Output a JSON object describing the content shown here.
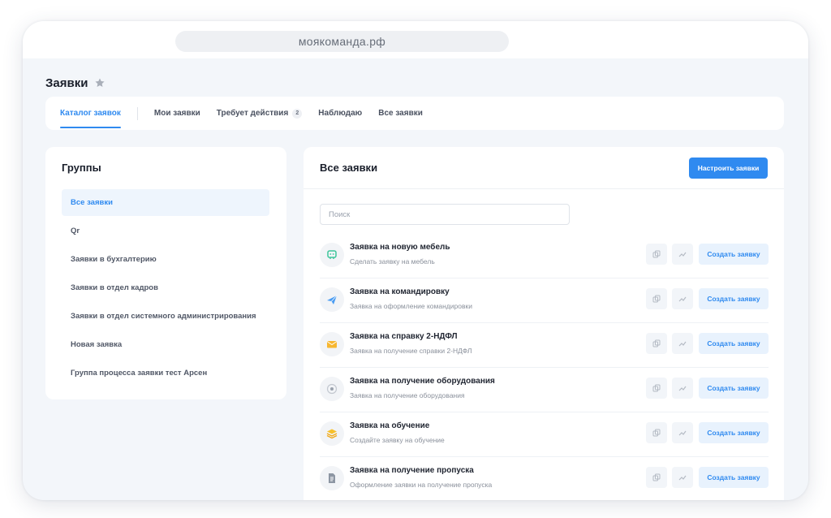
{
  "browser": {
    "url": "моякоманда.рф"
  },
  "page": {
    "title": "Заявки"
  },
  "tabs": [
    {
      "label": "Каталог заявок",
      "active": true
    },
    {
      "label": "Мои заявки"
    },
    {
      "label": "Требует действия",
      "badge": "2"
    },
    {
      "label": "Наблюдаю"
    },
    {
      "label": "Все заявки"
    }
  ],
  "groups": {
    "title": "Группы",
    "items": [
      {
        "label": "Все заявки",
        "active": true
      },
      {
        "label": "Qr"
      },
      {
        "label": "Заявки в бухгалтерию"
      },
      {
        "label": "Заявки в отдел кадров"
      },
      {
        "label": "Заявки в отдел системного администрирования"
      },
      {
        "label": "Новая заявка"
      },
      {
        "label": "Группа процесса заявки тест Арсен"
      }
    ]
  },
  "main": {
    "title": "Все заявки",
    "config_label": "Настроить заявки",
    "search_placeholder": "Поиск",
    "create_label": "Создать заявку",
    "requests": [
      {
        "title": "Заявка на новую мебель",
        "subtitle": "Сделать заявку на мебель",
        "icon": "furniture-robot-icon"
      },
      {
        "title": "Заявка на командировку",
        "subtitle": "Заявка на оформление командировки",
        "icon": "paper-plane-icon"
      },
      {
        "title": "Заявка на справку 2-НДФЛ",
        "subtitle": "Заявка на получение справки 2-НДФЛ",
        "icon": "envelope-icon"
      },
      {
        "title": "Заявка на получение оборудования",
        "subtitle": "Заявка на получение оборудования",
        "icon": "equipment-icon"
      },
      {
        "title": "Заявка на обучение",
        "subtitle": "Создайте заявку на обучение",
        "icon": "layers-icon"
      },
      {
        "title": "Заявка на получение пропуска",
        "subtitle": "Оформление заявки на получение пропуска",
        "icon": "document-icon"
      }
    ]
  },
  "colors": {
    "accent": "#2f8af0",
    "background": "#f3f6fa",
    "card": "#ffffff"
  }
}
